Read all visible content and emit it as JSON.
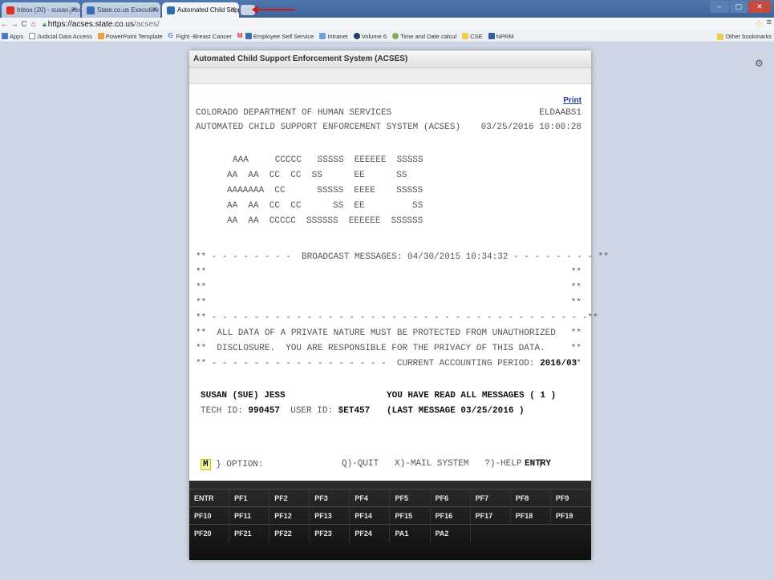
{
  "browser": {
    "tabs": [
      {
        "label": "Inbox (20) - susan.jess@...",
        "icon_color": "#d93025"
      },
      {
        "label": "State.co.us Executive Bra...",
        "icon_color": "#3b6bb5"
      },
      {
        "label": "Automated Child Support",
        "icon_color": "#2f6db0"
      }
    ],
    "url_host": "https://acses.state.co.us",
    "url_path": "/acses/",
    "bookmarks": [
      "Apps",
      "Judicial Data Access",
      "PowerPoint Template",
      "Fight -Breast Cancer",
      "Employee Self Service",
      "Intranet",
      "Volume 6",
      "Time and Date calcul",
      "CSE",
      "NPRM"
    ],
    "other_bookmarks": "Other bookmarks"
  },
  "app": {
    "title": "Automated Child Support Enforcement System (ACSES)",
    "print_link": "Print"
  },
  "terminal": {
    "header_left_1": "COLORADO DEPARTMENT OF HUMAN SERVICES",
    "header_right_1": "ELDAABS1",
    "header_left_2": "AUTOMATED CHILD SUPPORT ENFORCEMENT SYSTEM (ACSES)",
    "header_right_2": "03/25/2016 10:00:28",
    "banner": [
      "AAA     CCCCC   SSSSS  EEEEEE  SSSSS",
      "AA  AA  CC  CC  SS      EE      SS",
      "AAAAAAA  CC      SSSSS  EEEE    SSSSS",
      "AA  AA  CC  CC      SS  EE         SS",
      "AA  AA  CCCCC  SSSSSS  EEEEEE  SSSSSS"
    ],
    "broadcast": "** - - - - - - - -  BROADCAST MESSAGES: 04/30/2015 10:34:32 - - - - - - - - **",
    "star_left": "**",
    "star_right": "**",
    "dash_line": "** - - - - - - - - - - - - - - - - - - - - - - - - - - - - - - - - - - - -**",
    "privacy_1": "**  ALL DATA OF A PRIVATE NATURE MUST BE PROTECTED FROM UNAUTHORIZED",
    "privacy_2": "**  DISCLOSURE.  YOU ARE RESPONSIBLE FOR THE PRIVACY OF THIS DATA.",
    "accounting_prefix": "** - - - - - - - - - - - - - - - - -  CURRENT ACCOUNTING PERIOD: ",
    "accounting_period": "2016/03",
    "user_name": "SUSAN (SUE) JESS",
    "messages_status": "YOU HAVE READ ALL MESSAGES ( 1 )",
    "tech_id_label": "TECH ID: ",
    "tech_id": "990457",
    "user_id_label": "  USER ID: ",
    "user_id": "$ET457",
    "last_message": "(LAST MESSAGE 03/25/2016 )",
    "option_value": "M",
    "option_label": " } OPTION:",
    "commands": "Q)-QUIT   X)-MAIL SYSTEM   ?)-HELP   |",
    "entry_label": "ENTRY"
  },
  "function_keys": [
    [
      "ENTR",
      "PF1",
      "PF2",
      "PF3",
      "PF4",
      "PF5",
      "PF6",
      "PF7",
      "PF8",
      "PF9"
    ],
    [
      "PF10",
      "PF11",
      "PF12",
      "PF13",
      "PF14",
      "PF15",
      "PF16",
      "PF17",
      "PF18",
      "PF19"
    ],
    [
      "PF20",
      "PF21",
      "PF22",
      "PF23",
      "PF24",
      "PA1",
      "PA2"
    ]
  ]
}
